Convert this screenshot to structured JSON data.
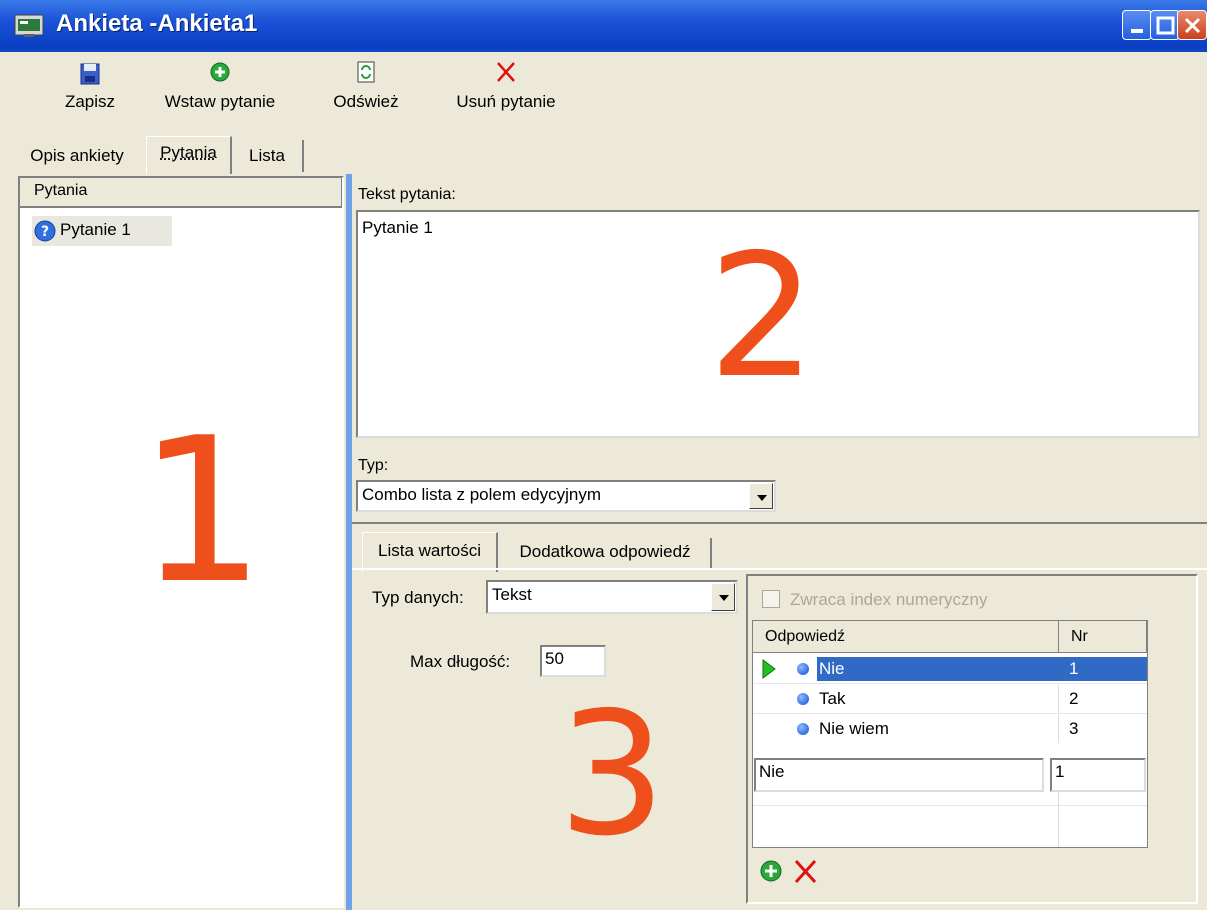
{
  "window": {
    "title": "Ankieta -Ankieta1"
  },
  "toolbar": {
    "save_label": "Zapisz",
    "insert_label": "Wstaw pytanie",
    "refresh_label": "Odśwież",
    "delete_label": "Usuń pytanie"
  },
  "tabs": {
    "description": "Opis ankiety",
    "questions": "Pytania",
    "list": "Lista",
    "active": "Pytania"
  },
  "questions_panel": {
    "header": "Pytania",
    "items": [
      "Pytanie 1"
    ],
    "marker": "1"
  },
  "question_editor": {
    "text_label": "Tekst pytania:",
    "text_value": "Pytanie 1",
    "marker": "2",
    "type_label": "Typ:",
    "type_value": "Combo lista z polem edycyjnym"
  },
  "values_panel": {
    "tabs": {
      "values_list": "Lista wartości",
      "extra_answer": "Dodatkowa odpowiedź",
      "active": "Lista wartości"
    },
    "data_type_label": "Typ danych:",
    "data_type_value": "Tekst",
    "max_length_label": "Max długość:",
    "max_length_value": "50",
    "marker": "3",
    "numeric_index_label": "Zwraca index numeryczny",
    "grid": {
      "columns": [
        "Odpowiedź",
        "Nr"
      ],
      "rows": [
        {
          "answer": "Nie",
          "nr": "1",
          "selected": true
        },
        {
          "answer": "Tak",
          "nr": "2",
          "selected": false
        },
        {
          "answer": "Nie wiem",
          "nr": "3",
          "selected": false
        }
      ],
      "edit_answer": "Nie",
      "edit_nr": "1"
    }
  },
  "colors": {
    "marker": "#ef4f1a",
    "selection": "#316ac5",
    "titlebar": "#0a3fc4"
  }
}
